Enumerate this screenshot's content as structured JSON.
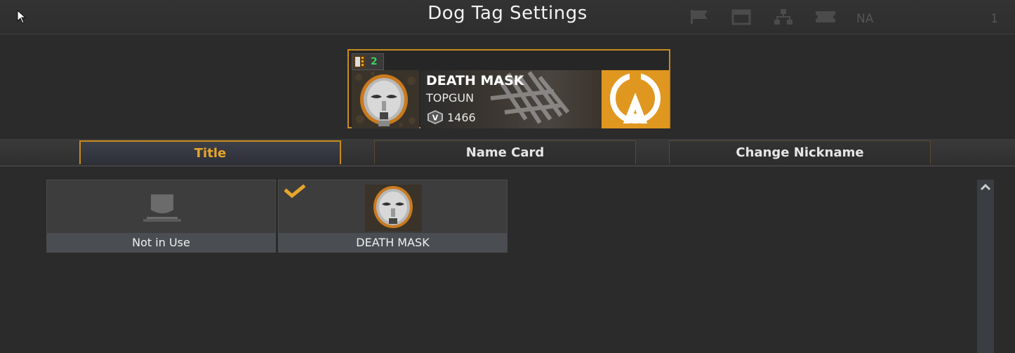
{
  "header": {
    "title": "Dog Tag Settings",
    "region": "NA",
    "corner_number": "1",
    "faint_icons": [
      "flag-icon",
      "calendar-icon",
      "network-icon",
      "ticket-icon"
    ]
  },
  "dog_tag": {
    "level": "2",
    "title": "DEATH MASK",
    "nickname": "TOPGUN",
    "rank_symbol": "V",
    "score": "1466",
    "emblem": "death-mask-icon",
    "logo": "a-emblem-icon"
  },
  "tabs": [
    {
      "label": "Title",
      "active": true
    },
    {
      "label": "Name Card",
      "active": false
    },
    {
      "label": "Change Nickname",
      "active": false
    }
  ],
  "items": [
    {
      "label": "Not in Use",
      "icon": "shield-placeholder-icon",
      "selected": false
    },
    {
      "label": "DEATH MASK",
      "icon": "death-mask-icon",
      "selected": true
    }
  ],
  "colors": {
    "accent": "#e7a52c",
    "accent_border": "#c98a1e",
    "level_green": "#3fcf5a",
    "logo_orange": "#e0971f",
    "background": "#2b2b2b"
  }
}
